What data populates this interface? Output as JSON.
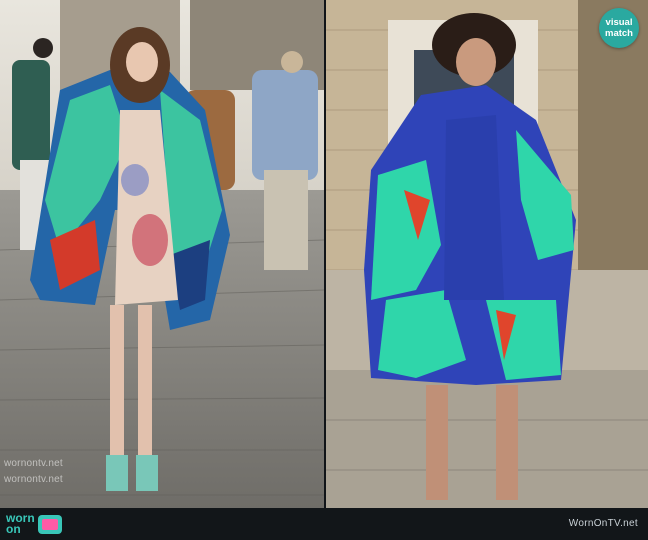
{
  "badge": {
    "line1": "visual",
    "line2": "match",
    "color": "#2aa9a0"
  },
  "watermark_text": "wornontv.net",
  "footer": {
    "logo_line1": "worn",
    "logo_line2": "on",
    "logo_icon": "tv-icon",
    "site_text": "WornOnTV.net",
    "accent": "#39c6b8"
  },
  "images": [
    {
      "name": "street-photo",
      "description": "woman in printed blue coat on cobblestone street"
    },
    {
      "name": "product-photo",
      "description": "model wearing the same printed coat against stone wall"
    }
  ]
}
